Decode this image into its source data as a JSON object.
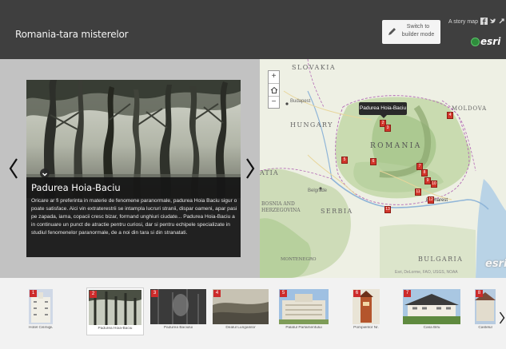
{
  "header": {
    "title": "Romania-tara misterelor",
    "builder_button_label": "Switch to builder mode",
    "storymap_link": "A story map",
    "social_icons": [
      "facebook-icon",
      "twitter-icon",
      "link-icon"
    ],
    "logo_text": "esri",
    "background": "#3f3f3f"
  },
  "section": {
    "title": "Padurea Hoia-Baciu",
    "body": "Oricare ar fi preferinta in materie de fenomene paranormale, padurea Hoia Baciu sigur o poate satisface. Aici vin extraterestrii se intampla lucruri stranii, dispar oameni, apar pasi pe zapada, iarna, copacii cresc bizar, formand unghiuri ciudate... Padurea Hoia-Baciu a in continuare un punct de atractie pentru curiosi, dar si pentru echipele specializate in studiul fenomenelor paranormale, de a noi din tara si din stranatati.",
    "prev_icon": "chevron-left-icon",
    "next_icon": "chevron-right-icon",
    "collapse_icon": "chevron-down-icon"
  },
  "map": {
    "zoom_in": "+",
    "home_icon": "home-icon",
    "zoom_out": "−",
    "popup_label": "Padurea Hoia-Baciu",
    "labels": {
      "slovakia": "SLOVAKIA",
      "hungary": "HUNGARY",
      "romania": "ROMANIA",
      "moldova": "MOLDOVA",
      "serbia": "SERBIA",
      "bosnia": "BOSNIA AND HERZEGOVINA",
      "bulgaria": "BULGARIA",
      "montenegro": "MONTENEGRO",
      "budapest": "Budapest",
      "bucharest": "Bucharest",
      "belgrade": "Belgrade",
      "atia": "ATIA"
    },
    "markers": [
      "2",
      "3",
      "4",
      "5",
      "6",
      "7",
      "8",
      "9",
      "10",
      "11",
      "12",
      "13"
    ],
    "attribution": "Esri, DeLorme, FAO, USGS, NOAA",
    "logo": "esri"
  },
  "carousel": {
    "items": [
      {
        "num": "1",
        "label": "Hotel Cismigiu"
      },
      {
        "num": "2",
        "label": "Padurea Hoia-Baciu"
      },
      {
        "num": "3",
        "label": "Padurea Baciului"
      },
      {
        "num": "4",
        "label": "Dealul Lunganilor"
      },
      {
        "num": "5",
        "label": "Palatul Parlamentului"
      },
      {
        "num": "6",
        "label": "Pompierilor Nr."
      },
      {
        "num": "7",
        "label": "Casa Bifu"
      },
      {
        "num": "8",
        "label": "Castelul"
      }
    ],
    "next_icon": "chevron-right-icon",
    "selected": "2"
  }
}
